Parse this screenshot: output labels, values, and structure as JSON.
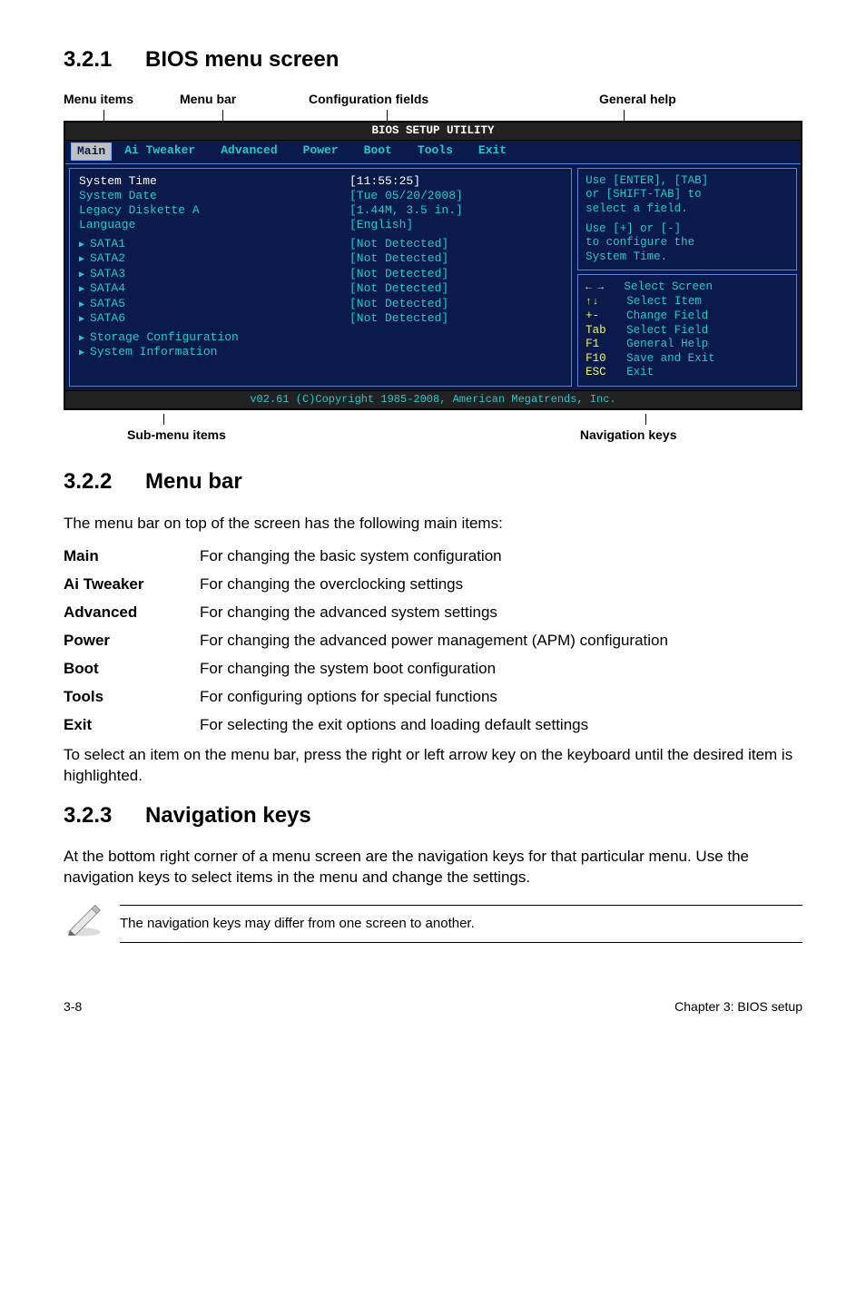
{
  "section1": {
    "num": "3.2.1",
    "title": "BIOS menu screen"
  },
  "toplabels": {
    "menu_items": "Menu items",
    "menu_bar": "Menu bar",
    "config_fields": "Configuration fields",
    "general_help": "General help"
  },
  "bios": {
    "title": "BIOS SETUP UTILITY",
    "menu": {
      "main": "Main",
      "ai_tweaker": "Ai Tweaker",
      "advanced": "Advanced",
      "power": "Power",
      "boot": "Boot",
      "tools": "Tools",
      "exit": "Exit"
    },
    "left": {
      "system_time_k": "System Time",
      "system_time_v": "[11:55:25]",
      "system_date_k": "System Date",
      "system_date_v": "[Tue 05/20/2008]",
      "legacy_k": "Legacy Diskette A",
      "legacy_v": "[1.44M, 3.5 in.]",
      "language_k": "Language",
      "language_v": "[English]",
      "sata1_k": "SATA1",
      "sata1_v": "[Not Detected]",
      "sata2_k": "SATA2",
      "sata2_v": "[Not Detected]",
      "sata3_k": "SATA3",
      "sata3_v": "[Not Detected]",
      "sata4_k": "SATA4",
      "sata4_v": "[Not Detected]",
      "sata5_k": "SATA5",
      "sata5_v": "[Not Detected]",
      "sata6_k": "SATA6",
      "sata6_v": "[Not Detected]",
      "storage": "Storage Configuration",
      "sysinfo": "System Information"
    },
    "help": {
      "line1": "Use [ENTER], [TAB]",
      "line2": "or [SHIFT-TAB] to",
      "line3": "select a field.",
      "line4": "Use [+] or [-]",
      "line5": "to configure the",
      "line6": "System Time."
    },
    "nav": {
      "select_screen": "Select Screen",
      "select_item": "Select Item",
      "plusminus": "+-",
      "change_field": "Change Field",
      "tab": "Tab",
      "select_field": "Select Field",
      "f1": "F1",
      "general_help": "General Help",
      "f10": "F10",
      "save_exit": "Save and Exit",
      "esc": "ESC",
      "exit": "Exit"
    },
    "footer": "v02.61 (C)Copyright 1985-2008, American Megatrends, Inc."
  },
  "sublabels": {
    "submenu": "Sub-menu items",
    "navkeys": "Navigation keys"
  },
  "section2": {
    "num": "3.2.2",
    "title": "Menu bar"
  },
  "section2_intro": "The menu bar on top of the screen has the following main items:",
  "defs": {
    "main_t": "Main",
    "main_d": "For changing the basic system configuration",
    "ai_t": "Ai Tweaker",
    "ai_d": "For changing the overclocking settings",
    "adv_t": "Advanced",
    "adv_d": "For changing the advanced system settings",
    "pow_t": "Power",
    "pow_d": "For changing the advanced power management (APM) configuration",
    "boot_t": "Boot",
    "boot_d": "For changing the system boot configuration",
    "tools_t": "Tools",
    "tools_d": "For configuring options for special functions",
    "exit_t": "Exit",
    "exit_d": "For selecting the exit options and loading default settings"
  },
  "section2_out": "To select an item on the menu bar, press the right or left arrow key on the keyboard until the desired item is highlighted.",
  "section3": {
    "num": "3.2.3",
    "title": "Navigation keys"
  },
  "section3_p": "At the bottom right corner of a menu screen are the navigation keys for that particular menu. Use the navigation keys to select items in the menu and change the settings.",
  "note": "The navigation keys may differ from one screen to another.",
  "footer": {
    "left": "3-8",
    "right": "Chapter 3: BIOS setup"
  }
}
